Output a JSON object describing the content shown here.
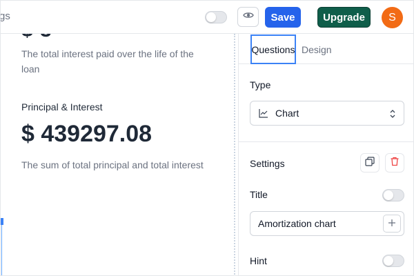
{
  "header": {
    "cut_text": "gs",
    "save_label": "Save",
    "upgrade_label": "Upgrade",
    "avatar_initial": "S"
  },
  "canvas": {
    "cut_number": "$ 3",
    "interest_description": "The total interest paid over the life of the loan",
    "principal_interest_label": "Principal & Interest",
    "principal_interest_value": "$ 439297.08",
    "principal_description": "The sum of total principal and total interest"
  },
  "panel": {
    "tabs": [
      {
        "label": "Questions",
        "active": true
      },
      {
        "label": "Design",
        "active": false
      }
    ],
    "type_label": "Type",
    "type_value": "Chart",
    "settings_label": "Settings",
    "title_label": "Title",
    "title_value": "Amortization chart",
    "hint_label": "Hint"
  },
  "colors": {
    "save": "#2563eb",
    "upgrade": "#0f5e4a",
    "avatar": "#f26b15",
    "trash": "#ef4444",
    "tab_outline": "#3b82f6"
  },
  "icons": [
    "eye-icon",
    "chart-line-icon",
    "chevron-up-down-icon",
    "copy-icon",
    "trash-icon",
    "plus-icon"
  ]
}
